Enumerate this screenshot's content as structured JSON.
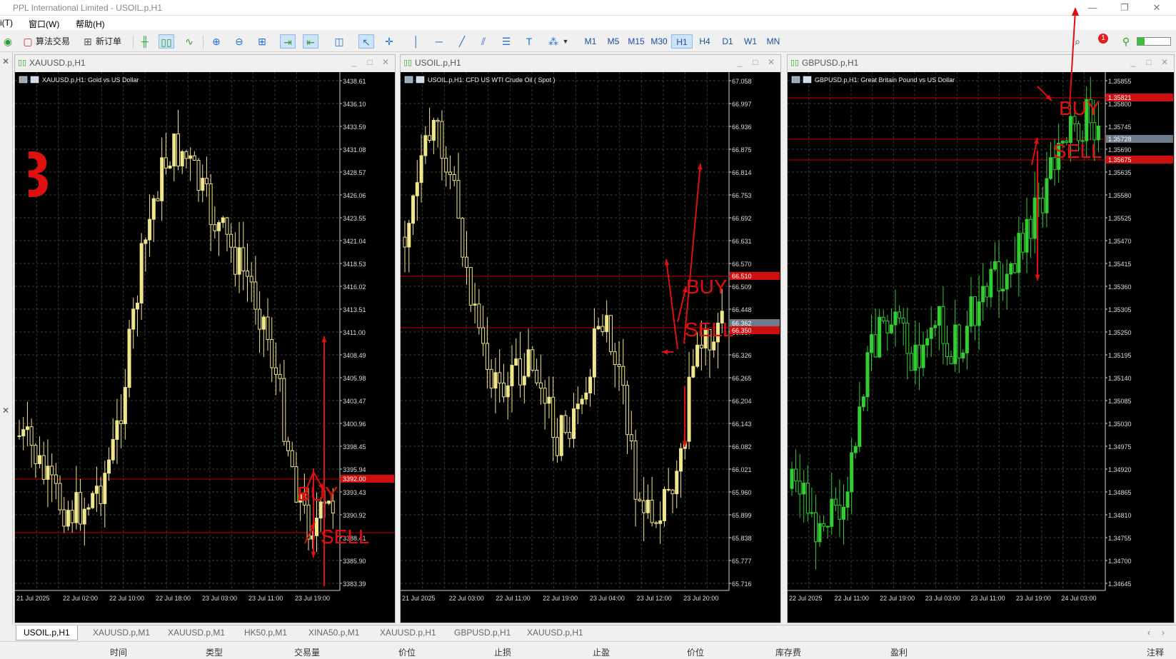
{
  "window": {
    "title": "PPL International Limited - USOIL.p,H1",
    "buttons": [
      "—",
      "❐",
      "✕"
    ]
  },
  "menu": {
    "items": [
      "i(T)",
      "窗口(W)",
      "帮助(H)"
    ]
  },
  "toolbar": {
    "algo_label": "算法交易",
    "neworder_label": "新订单",
    "timeframes": [
      "M1",
      "M5",
      "M15",
      "M30",
      "H1",
      "H4",
      "D1",
      "W1",
      "MN"
    ],
    "active_timeframe": "H1",
    "notification_count": "1"
  },
  "charts": [
    {
      "window_title": "XAUUSD.p,H1",
      "header": "XAUUSD.p,H1:  Gold vs US Dollar",
      "candle_color": "#f0e68c",
      "price_labels": [
        "3438.61",
        "3436.10",
        "3433.59",
        "3431.08",
        "3428.57",
        "3426.06",
        "3423.55",
        "3421.04",
        "3418.53",
        "3416.02",
        "3413.51",
        "3411.00",
        "3408.49",
        "3405.98",
        "3403.47",
        "3400.96",
        "3398.45",
        "3395.94",
        "3393.43",
        "3390.92",
        "3388.41",
        "3385.90",
        "3383.39"
      ],
      "time_labels": [
        "21 Jul 2025",
        "22 Jul 02:00",
        "22 Jul 10:00",
        "22 Jul 18:00",
        "23 Jul 03:00",
        "23 Jul 11:00",
        "23 Jul 19:00"
      ],
      "marked_prices": [
        "3392.00"
      ],
      "buy_text": "BUY",
      "sell_text": "SELL"
    },
    {
      "window_title": "USOIL.p,H1",
      "header": "USOIL.p,H1:  CFD US WTI Crude Oil ( Spot )",
      "candle_color": "#f0e68c",
      "price_labels": [
        "67.058",
        "66.997",
        "66.936",
        "66.875",
        "66.814",
        "66.753",
        "66.692",
        "66.631",
        "66.570",
        "66.509",
        "66.448",
        "66.387",
        "66.326",
        "66.265",
        "66.204",
        "66.143",
        "66.082",
        "66.021",
        "65.960",
        "65.899",
        "65.838",
        "65.777",
        "65.716"
      ],
      "time_labels": [
        "21 Jul 2025",
        "22 Jul 03:00",
        "22 Jul 11:00",
        "22 Jul 19:00",
        "23 Jul 04:00",
        "23 Jul 12:00",
        "23 Jul 20:00"
      ],
      "marked_prices": [
        "66.510",
        "66.362",
        "66.350"
      ],
      "buy_text": "BUY",
      "sell_text": "SELL"
    },
    {
      "window_title": "GBPUSD.p,H1",
      "header": "GBPUSD.p,H1:  Great Britain Pound vs US Dollar",
      "candle_color": "#32cd32",
      "price_labels": [
        "1.35855",
        "1.35800",
        "1.35745",
        "1.35690",
        "1.35635",
        "1.35580",
        "1.35525",
        "1.35470",
        "1.35415",
        "1.35360",
        "1.35305",
        "1.35250",
        "1.35195",
        "1.35140",
        "1.35085",
        "1.35030",
        "1.34975",
        "1.34920",
        "1.34865",
        "1.34810",
        "1.34755",
        "1.34700",
        "1.34645"
      ],
      "time_labels": [
        "22 Jul 2025",
        "22 Jul 11:00",
        "22 Jul 19:00",
        "23 Jul 03:00",
        "23 Jul 11:00",
        "23 Jul 19:00",
        "24 Jul 03:00"
      ],
      "marked_prices": [
        "1.35821",
        "1.35728",
        "1.35675"
      ],
      "buy_text": "BUY",
      "sell_text": "SELL"
    }
  ],
  "tabs": [
    "USOIL.p,H1",
    "XAUUSD.p,M1",
    "XAUUSD.p,M1",
    "HK50.p,M1",
    "XINA50.p,M1",
    "XAUUSD.p,H1",
    "GBPUSD.p,H1",
    "XAUUSD.p,H1"
  ],
  "active_tab": "USOIL.p,H1",
  "columns": [
    "时间",
    "类型",
    "交易量",
    "价位",
    "止损",
    "止盈",
    "价位",
    "库存费",
    "盈利",
    "注释"
  ],
  "overlay_digit": "3",
  "colors": {
    "arrow_red": "#e01010",
    "chart_bg": "#000000",
    "grid": "#3a3a3a",
    "level_red": "#cc0000"
  }
}
